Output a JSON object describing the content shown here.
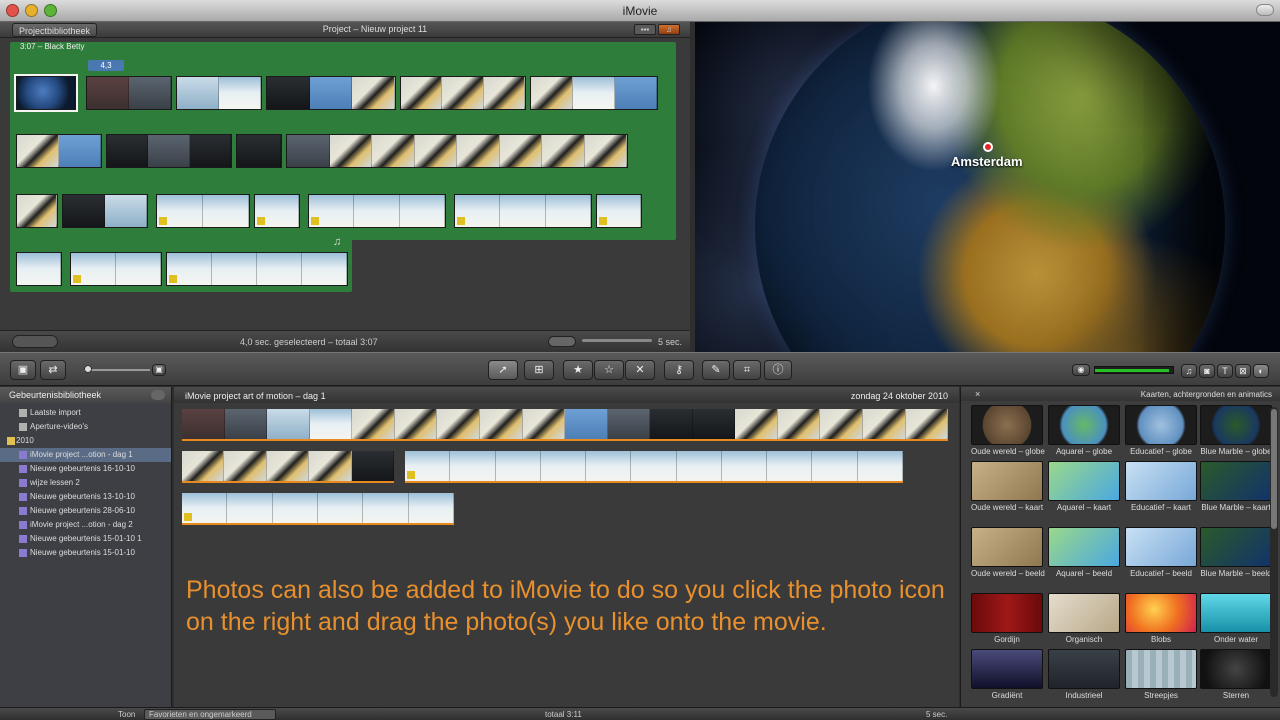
{
  "window": {
    "title": "iMovie"
  },
  "project": {
    "library_button": "Projectbibliotheek",
    "title": "Project – Nieuw project 11",
    "audio_clip_label": "3:07 – Black Betty",
    "duration_tag": "4,3",
    "status": "4,0 sec. geselecteerd – totaal 3:07",
    "zoom_label": "5 sec."
  },
  "viewer": {
    "location_label": "Amsterdam"
  },
  "events": {
    "header": "Gebeurtenisbibliotheek",
    "items": [
      {
        "label": "Laatste import"
      },
      {
        "label": "Aperture-video's"
      },
      {
        "label": "2010"
      },
      {
        "label": "iMovie project ...otion - dag 1"
      },
      {
        "label": "Nieuwe gebeurtenis 16-10-10"
      },
      {
        "label": "wijze lessen 2"
      },
      {
        "label": "Nieuwe gebeurtenis 13-10-10"
      },
      {
        "label": "Nieuwe gebeurtenis 28-06-10"
      },
      {
        "label": "iMovie project ...otion - dag 2"
      },
      {
        "label": "Nieuwe gebeurtenis 15-01-10 1"
      },
      {
        "label": "Nieuwe gebeurtenis 15-01-10"
      }
    ]
  },
  "browser": {
    "title": "iMovie project art of motion – dag 1",
    "date": "zondag 24 oktober 2010",
    "overlay_text": "Photos can also be added to iMovie to do so you click the photo icon on the right and drag the photo(s) you like onto the movie."
  },
  "backgrounds": {
    "title": "Kaarten, achtergronden en animatics",
    "close": "×",
    "tiles": [
      {
        "label": "Oude wereld – globe"
      },
      {
        "label": "Aquarel – globe"
      },
      {
        "label": "Educatief – globe"
      },
      {
        "label": "Blue Marble – globe"
      },
      {
        "label": "Oude wereld – kaart"
      },
      {
        "label": "Aquarel – kaart"
      },
      {
        "label": "Educatief – kaart"
      },
      {
        "label": "Blue Marble – kaart"
      },
      {
        "label": "Oude wereld – beeld"
      },
      {
        "label": "Aquarel – beeld"
      },
      {
        "label": "Educatief – beeld"
      },
      {
        "label": "Blue Marble – beeld"
      },
      {
        "label": "Gordijn"
      },
      {
        "label": "Organisch"
      },
      {
        "label": "Blobs"
      },
      {
        "label": "Onder water"
      },
      {
        "label": "Gradiënt"
      },
      {
        "label": "Industrieel"
      },
      {
        "label": "Streepjes"
      },
      {
        "label": "Sterren"
      }
    ]
  },
  "bottom": {
    "show_label": "Toon",
    "filter_value": "Favorieten en ongemarkeerd",
    "total": "totaal 3:11",
    "zoom_label": "5 sec."
  },
  "volume": {
    "level": 0.95
  },
  "colors": {
    "accent_orange": "#e8902e",
    "project_green": "#2f7d3a",
    "selection_blue": "#5a6b86"
  }
}
